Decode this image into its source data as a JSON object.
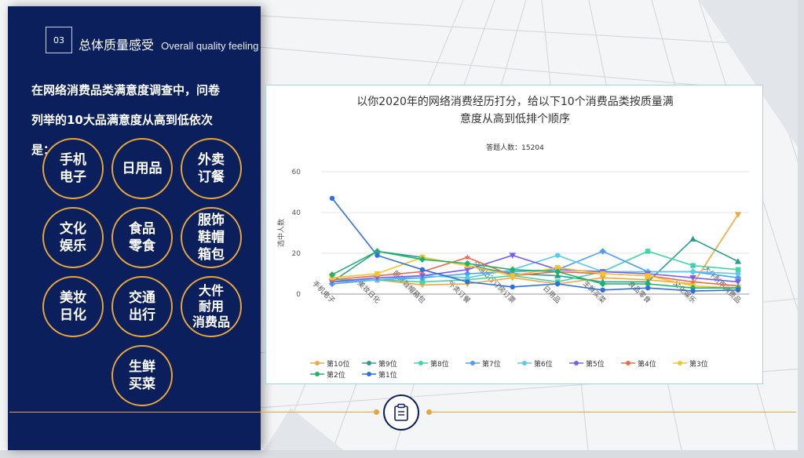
{
  "section": {
    "number": "03",
    "title_cn": "总体质量感受",
    "title_en": "Overall quality feeling"
  },
  "intro": {
    "line1": "在网络消费品类满意度调查中，问卷",
    "line2": "列举的10大品满意度从高到低依次是："
  },
  "categories_ranked": [
    "手机\n电子",
    "日用品",
    "外卖\n订餐",
    "文化\n娱乐",
    "食品\n零食",
    "服饰\n鞋帽\n箱包",
    "美妆\n日化",
    "交通\n出行",
    "大件\n耐用\n消费品",
    "生鲜\n买菜"
  ],
  "colors": {
    "panel": "#0b1f5c",
    "accent": "#e8a63a"
  },
  "icons": {
    "divider": "clipboard-icon"
  },
  "chart_data": {
    "type": "line",
    "title_line1": "以你2020年的网络消费经历打分，给以下10个消费品类按质量满",
    "title_line2": "意度从高到低排个顺序",
    "subtitle": "答题人数：15204",
    "ylabel": "选中人数",
    "ylim": [
      0,
      60
    ],
    "yticks": [
      "0",
      "20",
      "40",
      "60"
    ],
    "grid": true,
    "legend_position": "bottom",
    "categories": [
      "手机电子",
      "美妆日化",
      "服饰鞋帽箱包",
      "外卖订餐",
      "交通出行订房订票",
      "日用品",
      "生鲜买菜",
      "食品零食",
      "文化娱乐",
      "大件耐用消费品"
    ],
    "series": [
      {
        "name": "第10位",
        "color": "#f4a640",
        "marker": "triangle-down",
        "values": [
          6,
          7,
          4.5,
          5,
          8,
          5,
          8,
          7,
          5,
          39
        ]
      },
      {
        "name": "第9位",
        "color": "#2a9d8f",
        "marker": "triangle",
        "values": [
          6,
          21,
          18,
          14,
          10,
          9,
          6,
          6,
          27,
          16
        ]
      },
      {
        "name": "第8位",
        "color": "#3ed6a8",
        "marker": "square",
        "values": [
          7,
          7,
          6,
          7,
          9,
          6,
          11,
          21,
          14,
          12
        ]
      },
      {
        "name": "第7位",
        "color": "#4a9ef7",
        "marker": "diamond",
        "values": [
          5,
          7,
          8,
          10,
          11,
          12,
          21,
          11,
          11,
          8
        ]
      },
      {
        "name": "第6位",
        "color": "#5ac8ea",
        "marker": "circle",
        "values": [
          6,
          7,
          9,
          8,
          12,
          19,
          11,
          11,
          11,
          10
        ]
      },
      {
        "name": "第5位",
        "color": "#7b5cf0",
        "marker": "triangle-down",
        "values": [
          6,
          8,
          9,
          12,
          19,
          12,
          11,
          10,
          8,
          6
        ]
      },
      {
        "name": "第4位",
        "color": "#ee6a4d",
        "marker": "star",
        "values": [
          7,
          9,
          11,
          18,
          9,
          11,
          10,
          9,
          6,
          4
        ]
      },
      {
        "name": "第3位",
        "color": "#f6c428",
        "marker": "square",
        "values": [
          8,
          10,
          18,
          14,
          9,
          13,
          10,
          9,
          4,
          3
        ]
      },
      {
        "name": "第2位",
        "color": "#20b26a",
        "marker": "diamond",
        "values": [
          9.5,
          21,
          17,
          15,
          12,
          11,
          5,
          5,
          3,
          3
        ]
      },
      {
        "name": "第1位",
        "color": "#2f6fe0",
        "marker": "circle",
        "values": [
          47,
          19,
          12,
          6,
          3.5,
          5,
          2,
          3,
          1.5,
          2
        ]
      }
    ]
  }
}
